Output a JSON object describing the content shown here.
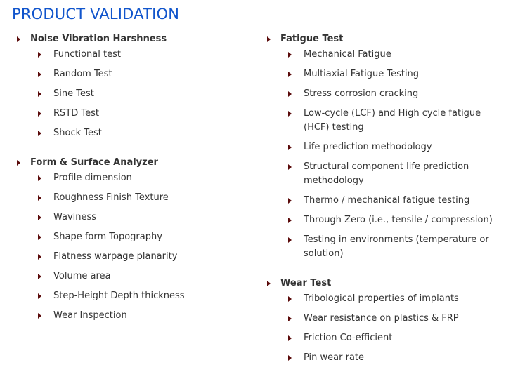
{
  "page": {
    "title": "PRODUCT VALIDATION",
    "bullet_color": "#5a0a0a",
    "title_color": "#1155cc"
  },
  "left_column": [
    {
      "heading": "Noise Vibration Harshness",
      "items": [
        "Functional test",
        "Random Test",
        "Sine Test",
        "RSTD Test",
        "Shock Test"
      ]
    },
    {
      "heading": "Form & Surface Analyzer",
      "items": [
        "Profile dimension",
        "Roughness Finish Texture",
        "Waviness",
        "Shape form Topography",
        "Flatness warpage planarity",
        "Volume area",
        "Step-Height Depth thickness",
        "Wear Inspection"
      ]
    }
  ],
  "right_column": [
    {
      "heading": "Fatigue Test",
      "items": [
        "Mechanical Fatigue",
        "Multiaxial Fatigue Testing",
        "Stress corrosion cracking",
        "Low-cycle (LCF) and High cycle fatigue (HCF) testing",
        "Life prediction methodology",
        "Structural component life prediction methodology",
        "Thermo / mechanical fatigue testing",
        "Through Zero (i.e., tensile / compression)",
        "Testing in environments (temperature or solution)"
      ]
    },
    {
      "heading": "Wear Test",
      "items": [
        "Tribological properties of implants",
        "Wear resistance on plastics & FRP",
        "Friction Co-efficient",
        "Pin wear rate"
      ]
    }
  ]
}
